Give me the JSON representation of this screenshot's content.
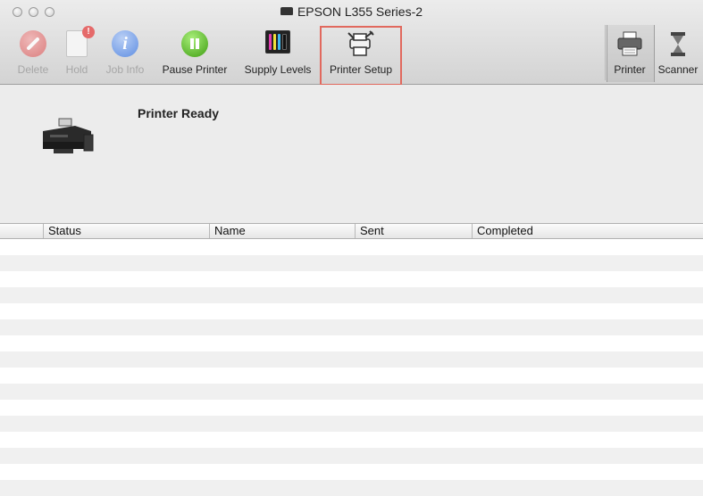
{
  "window": {
    "title": "EPSON L355 Series-2"
  },
  "toolbar": {
    "items": [
      {
        "label": "Delete",
        "icon": "delete-icon",
        "enabled": false
      },
      {
        "label": "Hold",
        "icon": "hold-icon",
        "badge": "!",
        "enabled": false
      },
      {
        "label": "Job Info",
        "icon": "info-icon",
        "enabled": false
      },
      {
        "label": "Pause Printer",
        "icon": "pause-icon",
        "enabled": true
      },
      {
        "label": "Supply Levels",
        "icon": "ink-levels-icon",
        "enabled": true
      },
      {
        "label": "Printer Setup",
        "icon": "printer-setup-icon",
        "enabled": true,
        "highlighted": true
      }
    ],
    "tabs": [
      {
        "label": "Printer",
        "icon": "printer-icon",
        "selected": true
      },
      {
        "label": "Scanner",
        "icon": "scanner-icon",
        "selected": false
      }
    ]
  },
  "status": {
    "text": "Printer Ready",
    "image": "epson-printer-image"
  },
  "jobs_table": {
    "columns": [
      "Status",
      "Name",
      "Sent",
      "Completed"
    ],
    "rows": []
  },
  "colors": {
    "highlight": "#e1695e",
    "pause_green": "#3f9e12",
    "info_blue": "#5f8ee2"
  }
}
